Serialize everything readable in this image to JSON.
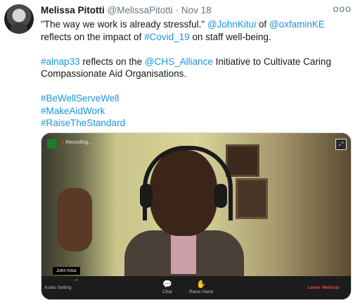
{
  "tweet": {
    "display_name": "Melissa Pitotti",
    "handle": "@MelissaPitotti",
    "separator": "·",
    "date": "Nov 18",
    "more": "ooo",
    "line1_a": "\"The way we work is already stressful.\" ",
    "mention1": "@JohnKitui",
    "line1_b": " of ",
    "mention2": "@oxfaminKE",
    "line1_c": " reflects on the impact of ",
    "tag_covid": "#Covid_19",
    "line1_d": " on staff well-being.",
    "tag_alnap": "#alnap33",
    "line2_a": " reflects on the ",
    "mention3": "@CHS_Alliance",
    "line2_b": " Initiative to Cultivate Caring Compassionate Aid Organisations.",
    "hashtags": [
      "#BeWellServeWell",
      "#MakeAidWork",
      "#RaiseTheStandard"
    ]
  },
  "video": {
    "recording_label": "Recording...",
    "speaker_name": "John Kitui",
    "toolbar": {
      "audio_label": "Audio Setting",
      "chat_label": "Chat",
      "raise_label": "Raise Hand",
      "leave_label": "Leave Webinar"
    }
  },
  "colors": {
    "link": "#1b95e0",
    "leave": "#e0483e"
  }
}
